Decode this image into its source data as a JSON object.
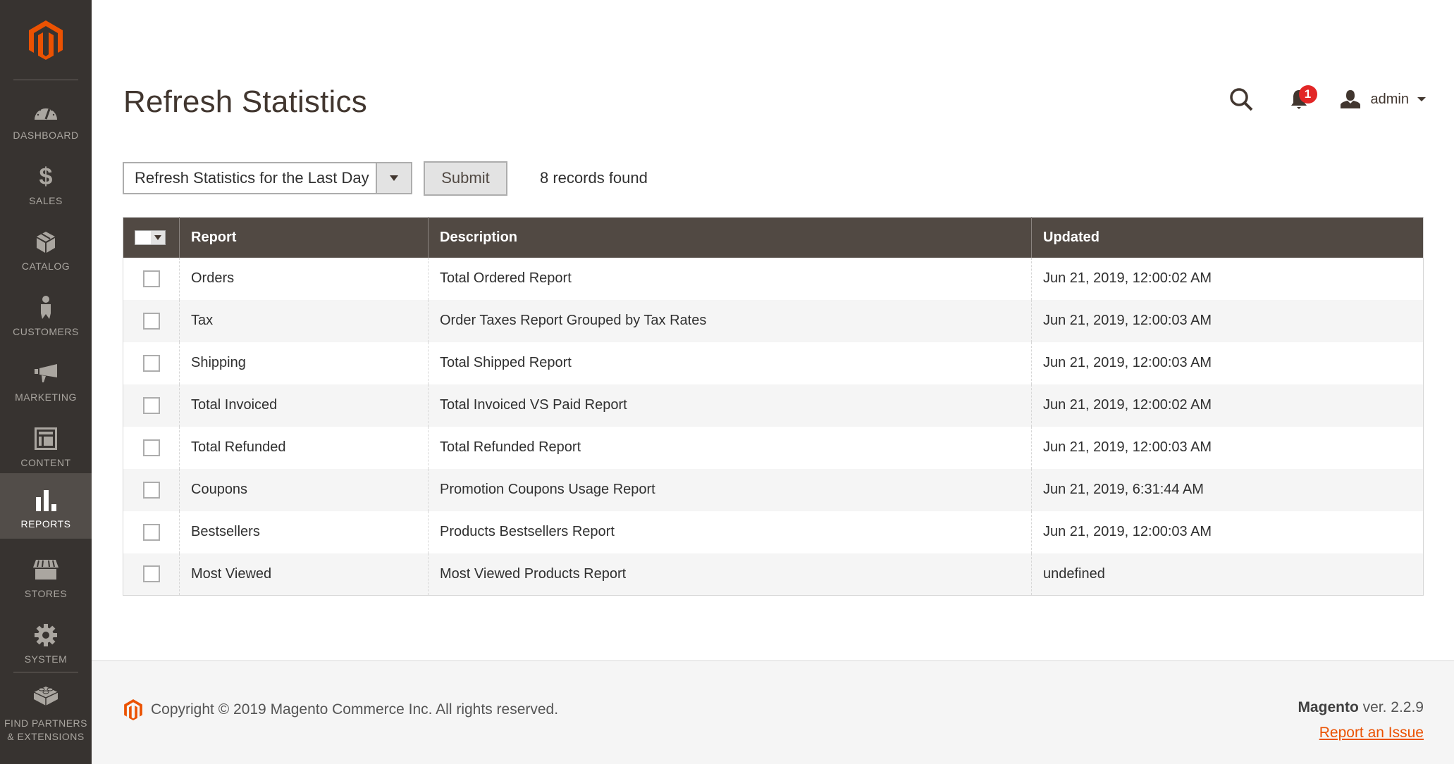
{
  "sidebar": {
    "items": [
      {
        "id": "dashboard",
        "label": "DASHBOARD",
        "icon": "dashboard-gauge-icon",
        "active": false
      },
      {
        "id": "sales",
        "label": "SALES",
        "icon": "dollar-icon",
        "active": false
      },
      {
        "id": "catalog",
        "label": "CATALOG",
        "icon": "box-icon",
        "active": false
      },
      {
        "id": "customers",
        "label": "CUSTOMERS",
        "icon": "person-icon",
        "active": false
      },
      {
        "id": "marketing",
        "label": "MARKETING",
        "icon": "megaphone-icon",
        "active": false
      },
      {
        "id": "content",
        "label": "CONTENT",
        "icon": "layout-icon",
        "active": false
      },
      {
        "id": "reports",
        "label": "REPORTS",
        "icon": "bar-chart-icon",
        "active": true
      },
      {
        "id": "stores",
        "label": "STORES",
        "icon": "storefront-icon",
        "active": false
      },
      {
        "id": "system",
        "label": "SYSTEM",
        "icon": "gear-icon",
        "active": false
      },
      {
        "id": "partners",
        "label_line1": "FIND PARTNERS",
        "label_line2": "& EXTENSIONS",
        "icon": "lego-brick-icon",
        "active": false
      }
    ]
  },
  "header": {
    "title": "Refresh Statistics",
    "notifications_count": "1",
    "user_name": "admin"
  },
  "toolbar": {
    "action_select_value": "Refresh Statistics for the Last Day",
    "submit_label": "Submit",
    "records_found": "8 records found"
  },
  "grid": {
    "columns": [
      "Report",
      "Description",
      "Updated"
    ],
    "rows": [
      {
        "report": "Orders",
        "description": "Total Ordered Report",
        "updated": "Jun 21, 2019, 12:00:02 AM"
      },
      {
        "report": "Tax",
        "description": "Order Taxes Report Grouped by Tax Rates",
        "updated": "Jun 21, 2019, 12:00:03 AM"
      },
      {
        "report": "Shipping",
        "description": "Total Shipped Report",
        "updated": "Jun 21, 2019, 12:00:03 AM"
      },
      {
        "report": "Total Invoiced",
        "description": "Total Invoiced VS Paid Report",
        "updated": "Jun 21, 2019, 12:00:02 AM"
      },
      {
        "report": "Total Refunded",
        "description": "Total Refunded Report",
        "updated": "Jun 21, 2019, 12:00:03 AM"
      },
      {
        "report": "Coupons",
        "description": "Promotion Coupons Usage Report",
        "updated": "Jun 21, 2019, 6:31:44 AM"
      },
      {
        "report": "Bestsellers",
        "description": "Products Bestsellers Report",
        "updated": "Jun 21, 2019, 12:00:03 AM"
      },
      {
        "report": "Most Viewed",
        "description": "Most Viewed Products Report",
        "updated": "undefined"
      }
    ]
  },
  "footer": {
    "copyright": "Copyright © 2019 Magento Commerce Inc. All rights reserved.",
    "brand": "Magento",
    "version": " ver. 2.2.9",
    "report_issue": "Report an Issue"
  },
  "colors": {
    "brand_orange": "#eb5202",
    "sidebar_bg": "#373330",
    "sidebar_active_bg": "#524d49",
    "grid_header_bg": "#514943",
    "badge_red": "#e22626"
  }
}
